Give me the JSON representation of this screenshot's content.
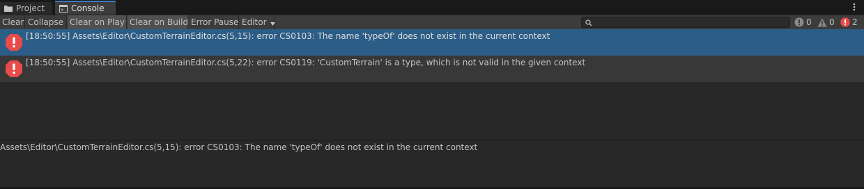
{
  "tabs": [
    {
      "label": "Project",
      "icon": "folder-icon"
    },
    {
      "label": "Console",
      "icon": "console-icon",
      "active": true
    }
  ],
  "toolbar": {
    "clear": "Clear",
    "collapse": "Collapse",
    "clear_on_play": "Clear on Play",
    "clear_on_build": "Clear on Build",
    "error_pause": "Error Pause",
    "editor": "Editor",
    "search_placeholder": "",
    "counts": {
      "info": "0",
      "warning": "0",
      "error": "2"
    }
  },
  "colors": {
    "accent": "#3a79bb",
    "selection": "#2c5d87",
    "error": "#e94b4b"
  },
  "log": [
    {
      "text": "[18:50:55] Assets\\Editor\\CustomTerrainEditor.cs(5,15): error CS0103: The name 'typeOf' does not exist in the current context",
      "type": "error",
      "selected": true
    },
    {
      "text": "[18:50:55] Assets\\Editor\\CustomTerrainEditor.cs(5,22): error CS0119: 'CustomTerrain' is a type, which is not valid in the given context",
      "type": "error",
      "selected": false
    }
  ],
  "detail": {
    "text": "Assets\\Editor\\CustomTerrainEditor.cs(5,15): error CS0103: The name 'typeOf' does not exist in the current context"
  }
}
